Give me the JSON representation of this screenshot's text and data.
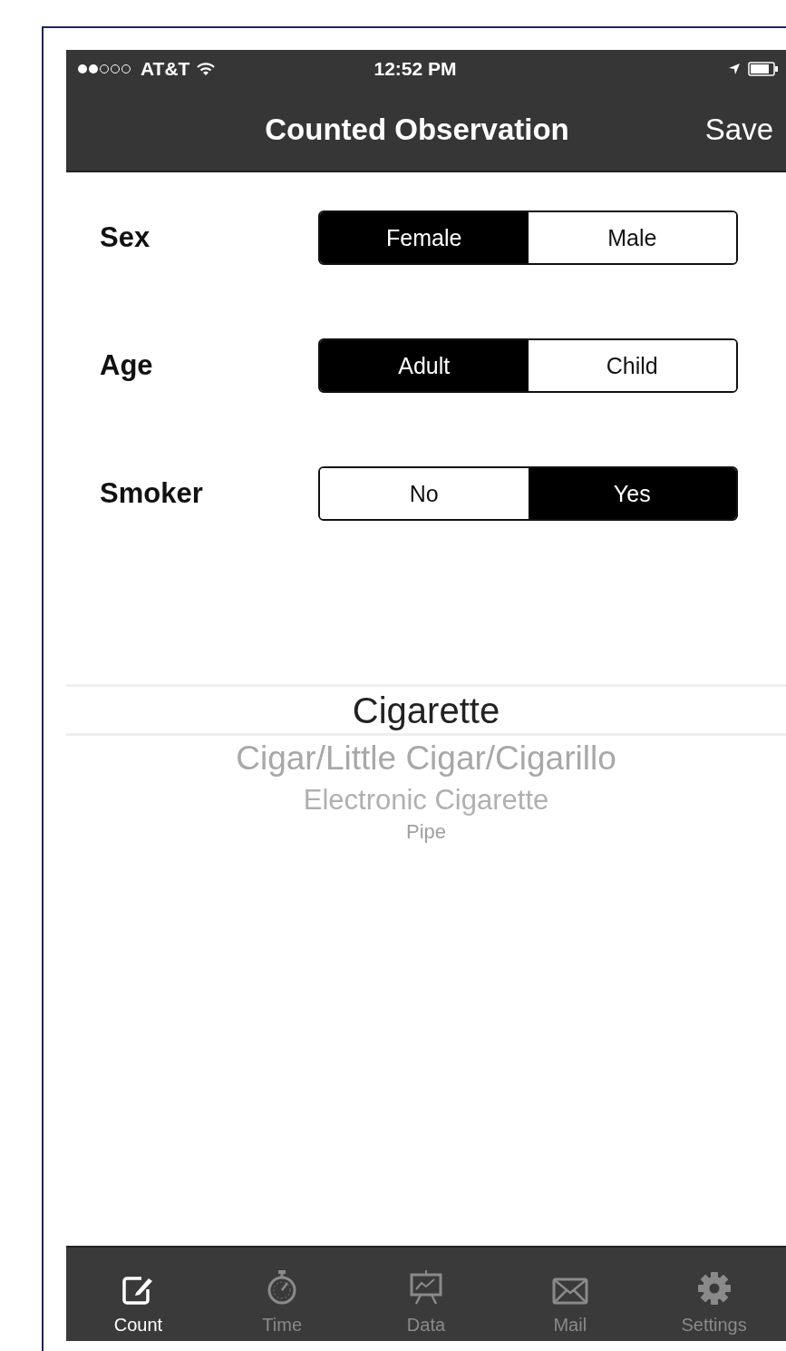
{
  "status_bar": {
    "carrier": "AT&T",
    "time": "12:52 PM"
  },
  "nav_bar": {
    "title": "Counted Observation",
    "action": "Save"
  },
  "fields": [
    {
      "label": "Sex",
      "options": [
        {
          "label": "Female",
          "selected": true
        },
        {
          "label": "Male",
          "selected": false
        }
      ]
    },
    {
      "label": "Age",
      "options": [
        {
          "label": "Adult",
          "selected": true
        },
        {
          "label": "Child",
          "selected": false
        }
      ]
    },
    {
      "label": "Smoker",
      "options": [
        {
          "label": "No",
          "selected": false
        },
        {
          "label": "Yes",
          "selected": true
        }
      ]
    }
  ],
  "picker": {
    "items": [
      {
        "label": "Cigarette",
        "selected": true
      },
      {
        "label": "Cigar/Little Cigar/Cigarillo",
        "selected": false
      },
      {
        "label": "Electronic Cigarette",
        "selected": false
      },
      {
        "label": "Pipe",
        "selected": false
      }
    ]
  },
  "tab_bar": {
    "tabs": [
      {
        "label": "Count",
        "selected": true
      },
      {
        "label": "Time",
        "selected": false
      },
      {
        "label": "Data",
        "selected": false
      },
      {
        "label": "Mail",
        "selected": false
      },
      {
        "label": "Settings",
        "selected": false
      }
    ]
  }
}
